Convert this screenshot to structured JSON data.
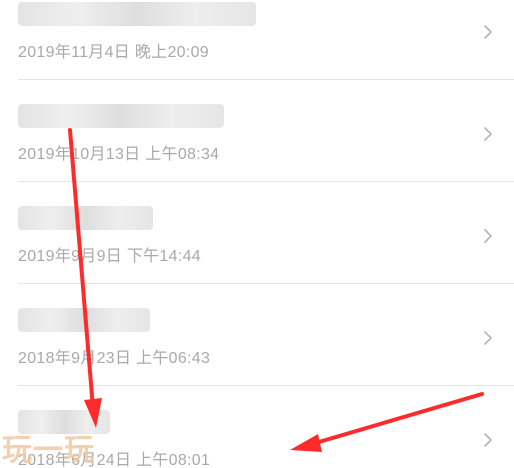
{
  "devices": [
    {
      "title": "",
      "date": "2019年11月4日 晚上20:09",
      "title_partial": true
    },
    {
      "title": "",
      "date": "2019年10月13日 上午08:34",
      "title_partial": true
    },
    {
      "title": "",
      "date": "2019年9月9日 下午14:44",
      "title_partial": true
    },
    {
      "title": "",
      "date": "2018年9月23日 上午06:43",
      "title_partial": true
    },
    {
      "title": "",
      "date": "2018年6月24日 上午08:01",
      "title_partial": true
    }
  ],
  "icons": {
    "chevron": "chevron-right-icon"
  },
  "colors": {
    "title": "#333333",
    "date": "#a9a9a9",
    "divider": "#e6e6e6",
    "chevron": "#b8b8b8",
    "annotation_arrow": "#ff2a2a",
    "watermark": "#f0c9a2"
  },
  "watermark": {
    "text": "玩一玩"
  }
}
